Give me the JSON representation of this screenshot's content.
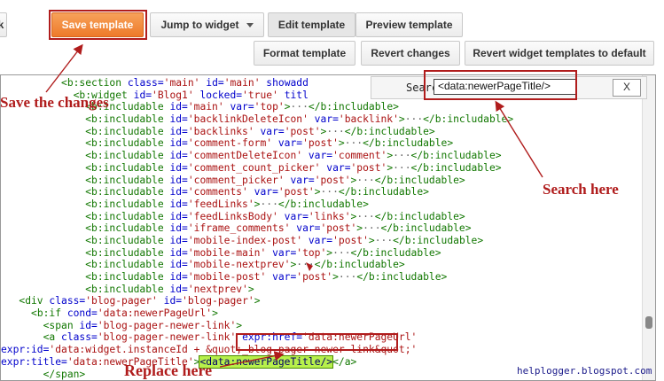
{
  "toolbar": {
    "row1": {
      "save": "Save template",
      "jump": "Jump to widget",
      "edit": "Edit template",
      "preview": "Preview template"
    },
    "row2": {
      "format": "Format template",
      "revert": "Revert changes",
      "revert_widgets": "Revert widget templates to default"
    },
    "left_stub": "k"
  },
  "search": {
    "label": "Search:",
    "value": "<data:newerPageTitle/>",
    "close": "X"
  },
  "annotations": {
    "save": "Save the changes",
    "search": "Search here",
    "replace": "Replace here",
    "watermark": "helplogger.blogspot.com"
  },
  "colors": {
    "accent_orange": "#ee7a2a",
    "annotation_red": "#b01c1c",
    "highlight_green": "#b7f04b"
  },
  "code_lines": [
    {
      "indent": "          ",
      "parts": [
        [
          "tag",
          "<b:section "
        ],
        [
          "attr",
          "class="
        ],
        [
          "val",
          "'main'"
        ],
        [
          "attr",
          " id="
        ],
        [
          "val",
          "'main'"
        ],
        [
          "attr",
          " showadd"
        ]
      ]
    },
    {
      "indent": "            ",
      "parts": [
        [
          "tag",
          "<b:widget "
        ],
        [
          "attr",
          "id="
        ],
        [
          "val",
          "'Blog1'"
        ],
        [
          "attr",
          " locked="
        ],
        [
          "val",
          "'true'"
        ],
        [
          "attr",
          " titl"
        ]
      ]
    },
    {
      "indent": "              ",
      "parts": [
        [
          "tag",
          "<b:includable "
        ],
        [
          "attr",
          "id="
        ],
        [
          "val",
          "'main'"
        ],
        [
          "attr",
          " var="
        ],
        [
          "val",
          "'top'"
        ],
        [
          "tag",
          ">"
        ],
        [
          "fold",
          "···"
        ],
        [
          "tag",
          "</b:includable>"
        ]
      ]
    },
    {
      "indent": "              ",
      "parts": [
        [
          "tag",
          "<b:includable "
        ],
        [
          "attr",
          "id="
        ],
        [
          "val",
          "'backlinkDeleteIcon'"
        ],
        [
          "attr",
          " var="
        ],
        [
          "val",
          "'backlink'"
        ],
        [
          "tag",
          ">"
        ],
        [
          "fold",
          "···"
        ],
        [
          "tag",
          "</b:includable>"
        ]
      ]
    },
    {
      "indent": "              ",
      "parts": [
        [
          "tag",
          "<b:includable "
        ],
        [
          "attr",
          "id="
        ],
        [
          "val",
          "'backlinks'"
        ],
        [
          "attr",
          " var="
        ],
        [
          "val",
          "'post'"
        ],
        [
          "tag",
          ">"
        ],
        [
          "fold",
          "···"
        ],
        [
          "tag",
          "</b:includable>"
        ]
      ]
    },
    {
      "indent": "              ",
      "parts": [
        [
          "tag",
          "<b:includable "
        ],
        [
          "attr",
          "id="
        ],
        [
          "val",
          "'comment-form'"
        ],
        [
          "attr",
          " var="
        ],
        [
          "val",
          "'post'"
        ],
        [
          "tag",
          ">"
        ],
        [
          "fold",
          "···"
        ],
        [
          "tag",
          "</b:includable>"
        ]
      ]
    },
    {
      "indent": "              ",
      "parts": [
        [
          "tag",
          "<b:includable "
        ],
        [
          "attr",
          "id="
        ],
        [
          "val",
          "'commentDeleteIcon'"
        ],
        [
          "attr",
          " var="
        ],
        [
          "val",
          "'comment'"
        ],
        [
          "tag",
          ">"
        ],
        [
          "fold",
          "···"
        ],
        [
          "tag",
          "</b:includable>"
        ]
      ]
    },
    {
      "indent": "              ",
      "parts": [
        [
          "tag",
          "<b:includable "
        ],
        [
          "attr",
          "id="
        ],
        [
          "val",
          "'comment_count_picker'"
        ],
        [
          "attr",
          " var="
        ],
        [
          "val",
          "'post'"
        ],
        [
          "tag",
          ">"
        ],
        [
          "fold",
          "···"
        ],
        [
          "tag",
          "</b:includable>"
        ]
      ]
    },
    {
      "indent": "              ",
      "parts": [
        [
          "tag",
          "<b:includable "
        ],
        [
          "attr",
          "id="
        ],
        [
          "val",
          "'comment_picker'"
        ],
        [
          "attr",
          " var="
        ],
        [
          "val",
          "'post'"
        ],
        [
          "tag",
          ">"
        ],
        [
          "fold",
          "···"
        ],
        [
          "tag",
          "</b:includable>"
        ]
      ]
    },
    {
      "indent": "              ",
      "parts": [
        [
          "tag",
          "<b:includable "
        ],
        [
          "attr",
          "id="
        ],
        [
          "val",
          "'comments'"
        ],
        [
          "attr",
          " var="
        ],
        [
          "val",
          "'post'"
        ],
        [
          "tag",
          ">"
        ],
        [
          "fold",
          "···"
        ],
        [
          "tag",
          "</b:includable>"
        ]
      ]
    },
    {
      "indent": "              ",
      "parts": [
        [
          "tag",
          "<b:includable "
        ],
        [
          "attr",
          "id="
        ],
        [
          "val",
          "'feedLinks'"
        ],
        [
          "tag",
          ">"
        ],
        [
          "fold",
          "···"
        ],
        [
          "tag",
          "</b:includable>"
        ]
      ]
    },
    {
      "indent": "              ",
      "parts": [
        [
          "tag",
          "<b:includable "
        ],
        [
          "attr",
          "id="
        ],
        [
          "val",
          "'feedLinksBody'"
        ],
        [
          "attr",
          " var="
        ],
        [
          "val",
          "'links'"
        ],
        [
          "tag",
          ">"
        ],
        [
          "fold",
          "···"
        ],
        [
          "tag",
          "</b:includable>"
        ]
      ]
    },
    {
      "indent": "              ",
      "parts": [
        [
          "tag",
          "<b:includable "
        ],
        [
          "attr",
          "id="
        ],
        [
          "val",
          "'iframe_comments'"
        ],
        [
          "attr",
          " var="
        ],
        [
          "val",
          "'post'"
        ],
        [
          "tag",
          ">"
        ],
        [
          "fold",
          "···"
        ],
        [
          "tag",
          "</b:includable>"
        ]
      ]
    },
    {
      "indent": "              ",
      "parts": [
        [
          "tag",
          "<b:includable "
        ],
        [
          "attr",
          "id="
        ],
        [
          "val",
          "'mobile-index-post'"
        ],
        [
          "attr",
          " var="
        ],
        [
          "val",
          "'post'"
        ],
        [
          "tag",
          ">"
        ],
        [
          "fold",
          "···"
        ],
        [
          "tag",
          "</b:includable>"
        ]
      ]
    },
    {
      "indent": "              ",
      "parts": [
        [
          "tag",
          "<b:includable "
        ],
        [
          "attr",
          "id="
        ],
        [
          "val",
          "'mobile-main'"
        ],
        [
          "attr",
          " var="
        ],
        [
          "val",
          "'top'"
        ],
        [
          "tag",
          ">"
        ],
        [
          "fold",
          "···"
        ],
        [
          "tag",
          "</b:includable>"
        ]
      ]
    },
    {
      "indent": "              ",
      "parts": [
        [
          "tag",
          "<b:includable "
        ],
        [
          "attr",
          "id="
        ],
        [
          "val",
          "'mobile-nextprev'"
        ],
        [
          "tag",
          ">"
        ],
        [
          "fold",
          "···"
        ],
        [
          "tag",
          "</b:includable>"
        ]
      ]
    },
    {
      "indent": "              ",
      "parts": [
        [
          "tag",
          "<b:includable "
        ],
        [
          "attr",
          "id="
        ],
        [
          "val",
          "'mobile-post'"
        ],
        [
          "attr",
          " var="
        ],
        [
          "val",
          "'post'"
        ],
        [
          "tag",
          ">"
        ],
        [
          "fold",
          "···"
        ],
        [
          "tag",
          "</b:includable>"
        ]
      ]
    },
    {
      "indent": "              ",
      "parts": [
        [
          "tag",
          "<b:includable "
        ],
        [
          "attr",
          "id="
        ],
        [
          "val",
          "'nextprev'"
        ],
        [
          "tag",
          ">"
        ]
      ]
    },
    {
      "indent": "   ",
      "parts": [
        [
          "tag",
          "<div "
        ],
        [
          "attr",
          "class="
        ],
        [
          "val",
          "'blog-pager'"
        ],
        [
          "attr",
          " id="
        ],
        [
          "val",
          "'blog-pager'"
        ],
        [
          "tag",
          ">"
        ]
      ]
    },
    {
      "indent": "     ",
      "parts": [
        [
          "tag",
          "<b:if "
        ],
        [
          "attr",
          "cond="
        ],
        [
          "val",
          "'data:newerPageUrl'"
        ],
        [
          "tag",
          ">"
        ]
      ]
    },
    {
      "indent": "       ",
      "parts": [
        [
          "tag",
          "<span "
        ],
        [
          "attr",
          "id="
        ],
        [
          "val",
          "'blog-pager-newer-link'"
        ],
        [
          "tag",
          ">"
        ]
      ]
    },
    {
      "indent": "       ",
      "parts": [
        [
          "tag",
          "<a "
        ],
        [
          "attr",
          "class="
        ],
        [
          "val",
          "'blog-pager-newer-link'"
        ],
        [
          "attr",
          " expr:href="
        ],
        [
          "val",
          "'data:newerPageUrl'"
        ]
      ]
    },
    {
      "indent": "",
      "parts": [
        [
          "attr",
          "expr:id="
        ],
        [
          "val",
          "'data:widget.instanceId + &quot;_blog-pager-newer-link&quot;'"
        ]
      ]
    },
    {
      "indent": "",
      "parts": [
        [
          "attr",
          "expr:title="
        ],
        [
          "val",
          "'data:newerPageTitle'"
        ],
        [
          "tag",
          ">"
        ],
        [
          "hl",
          "<data:newerPageTitle/>"
        ],
        [
          "tag",
          "</a>"
        ]
      ]
    },
    {
      "indent": "       ",
      "parts": [
        [
          "tag",
          "</span>"
        ]
      ]
    },
    {
      "indent": "     ",
      "parts": [
        [
          "tag",
          "</b:if>"
        ]
      ]
    }
  ]
}
